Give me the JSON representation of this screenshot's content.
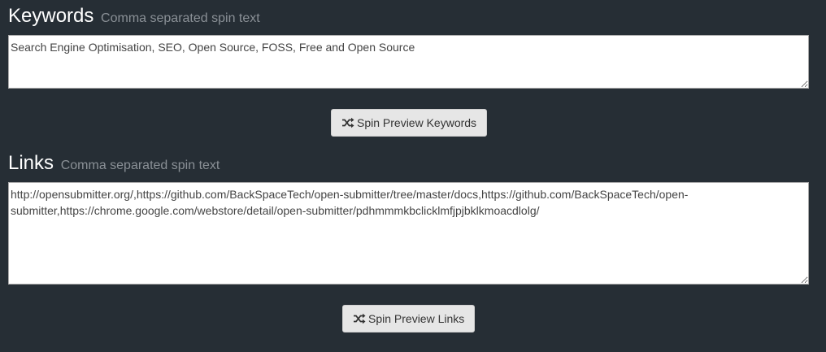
{
  "keywords": {
    "title": "Keywords",
    "hint": "Comma separated spin text",
    "value": "Search Engine Optimisation, SEO, Open Source, FOSS, Free and Open Source",
    "button_label": "Spin Preview Keywords",
    "button_icon": "shuffle-icon"
  },
  "links": {
    "title": "Links",
    "hint": "Comma separated spin text",
    "value": "http://opensubmitter.org/,https://github.com/BackSpaceTech/open-submitter/tree/master/docs,https://github.com/BackSpaceTech/open-submitter,https://chrome.google.com/webstore/detail/open-submitter/pdhmmmkbclicklmfjpjbklkmoacdlolg/",
    "button_label": "Spin Preview Links",
    "button_icon": "shuffle-icon"
  },
  "colors": {
    "background": "#262e35",
    "hint": "#8a9096",
    "button_bg": "#e6e6e6",
    "button_text": "#333333"
  }
}
